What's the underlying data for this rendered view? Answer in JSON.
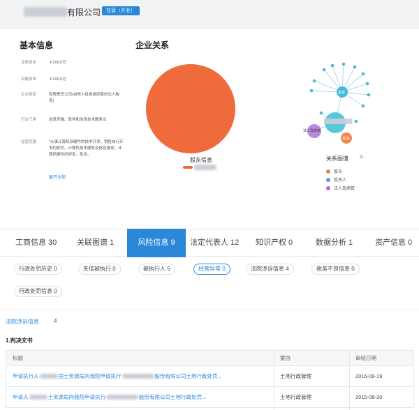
{
  "header": {
    "company_name": "有限公司",
    "status_badge": "在营（开业）"
  },
  "basic_info": {
    "title": "基本信息",
    "rows": [
      {
        "key": "注册资本",
        "value": "￥200.0万"
      },
      {
        "key": "实缴资本",
        "value": "￥200.0万"
      },
      {
        "key": "企业类型",
        "value": "有限责任公司(自然人投资或控股的法人独资)"
      },
      {
        "key": "行业门类",
        "value": "信息传输、软件和信息技术服务业"
      },
      {
        "key": "经营范围",
        "value": "*从事计算机软硬件的技术开发，销售自行开发的软件。计算机技术服务及信息服务；计算机硬件的研发、批发。"
      }
    ],
    "expand_all": "展开全部"
  },
  "relations": {
    "title": "企业关系",
    "shareholder_label": "股东信息",
    "graph_label": "关系图谱",
    "graph_icon": "⧉",
    "graph_nodes": [
      "投资",
      "法人及高管",
      "股东"
    ],
    "legend": [
      {
        "label": "股东",
        "color": "#f0813c"
      },
      {
        "label": "投资人",
        "color": "#4fa3e0"
      },
      {
        "label": "法人及高管",
        "color": "#b36bd6"
      }
    ]
  },
  "tabs": [
    {
      "label": "工商信息 30"
    },
    {
      "label": "关联图谱 1"
    },
    {
      "label": "风险信息 9"
    },
    {
      "label": "法定代表人 12"
    },
    {
      "label": "知识产权 0"
    },
    {
      "label": "数据分析 1"
    },
    {
      "label": "资产信息 0"
    }
  ],
  "sub_tabs": [
    {
      "label": "行政处罚历史 0"
    },
    {
      "label": "失信被执行 0"
    },
    {
      "label": "被执行人 5"
    },
    {
      "label": "经营异常 0"
    },
    {
      "label": "法院涉诉信息 4"
    },
    {
      "label": "税务不良信息 0"
    },
    {
      "label": "行政处罚信息 0"
    }
  ],
  "litigation": {
    "label": "法院涉诉信息",
    "count": "4",
    "section_title": "1.判决文书",
    "columns": [
      "标题",
      "案由",
      "审结日期"
    ],
    "rows": [
      {
        "title_a": "申请执行人",
        "title_b": "国土资源局向我院申请执行",
        "title_c": "股份有限公司土地行政处罚...",
        "cause": "土地行政管理",
        "date": "2016-09-19"
      },
      {
        "title_a": "申请人",
        "title_b": "土资源局向我院申请执行",
        "title_c": "股份有限公司土地行政处罚...",
        "cause": "土地行政管理",
        "date": "2015-08-20"
      }
    ]
  },
  "colors": {
    "accent": "#2b87d8",
    "pie": "#f06b3c",
    "graph_node": "#49b9d6"
  },
  "icons": {
    "graph_expand": "expand-icon"
  }
}
